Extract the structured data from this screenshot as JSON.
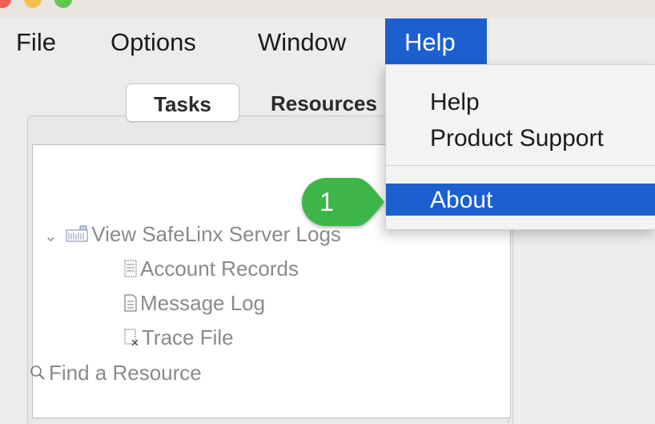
{
  "menubar": {
    "items": [
      {
        "label": "File"
      },
      {
        "label": "Options"
      },
      {
        "label": "Window"
      },
      {
        "label": "Help"
      }
    ]
  },
  "tabs": {
    "tasks": "Tasks",
    "resources": "Resources"
  },
  "tree": {
    "root": "View SafeLinx Server Logs",
    "children": [
      "Account Records",
      "Message Log",
      "Trace File"
    ],
    "find": "Find a Resource"
  },
  "help_menu": {
    "items": [
      "Help",
      "Product Support",
      "About"
    ],
    "selected": "About"
  },
  "callout": {
    "number": "1",
    "color": "#3cb54a"
  },
  "colors": {
    "accent": "#1c5fcf",
    "callout": "#3cb54a"
  }
}
